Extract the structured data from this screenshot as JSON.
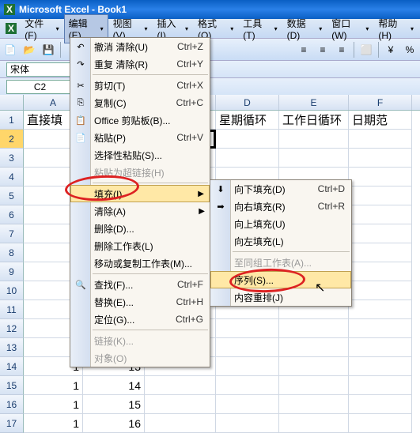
{
  "title": "Microsoft Excel - Book1",
  "menus": {
    "file": "文件(F)",
    "edit": "编辑(E)",
    "view": "视图(V)",
    "insert": "插入(I)",
    "format": "格式(O)",
    "tools": "工具(T)",
    "data": "数据(D)",
    "window": "窗口(W)",
    "help": "帮助(H)"
  },
  "font_name": "宋体",
  "name_box": "C2",
  "columns": [
    "A",
    "B",
    "C",
    "D",
    "E",
    "F"
  ],
  "header_row": {
    "A": "直接填",
    "D": "星期循环",
    "E": "工作日循环",
    "F": "日期范"
  },
  "data_rows": [
    {
      "n": 14,
      "A": "1",
      "B": "13"
    },
    {
      "n": 15,
      "A": "1",
      "B": "14"
    },
    {
      "n": 16,
      "A": "1",
      "B": "15"
    },
    {
      "n": 17,
      "A": "1",
      "B": "16"
    }
  ],
  "edit_menu": [
    {
      "icon": "↶",
      "label": "撤消 清除(U)",
      "shortcut": "Ctrl+Z"
    },
    {
      "icon": "↷",
      "label": "重复 清除(R)",
      "shortcut": "Ctrl+Y"
    },
    {
      "sep": true
    },
    {
      "icon": "✂",
      "label": "剪切(T)",
      "shortcut": "Ctrl+X"
    },
    {
      "icon": "⎘",
      "label": "复制(C)",
      "shortcut": "Ctrl+C"
    },
    {
      "icon": "📋",
      "label": "Office 剪贴板(B)..."
    },
    {
      "icon": "📄",
      "label": "粘贴(P)",
      "shortcut": "Ctrl+V"
    },
    {
      "label": "选择性粘贴(S)..."
    },
    {
      "label": "粘贴为超链接(H)",
      "disabled": true
    },
    {
      "sep": true
    },
    {
      "label": "填充(I)",
      "arrow": true,
      "hover": true
    },
    {
      "label": "清除(A)",
      "arrow": true
    },
    {
      "label": "删除(D)..."
    },
    {
      "label": "删除工作表(L)"
    },
    {
      "label": "移动或复制工作表(M)..."
    },
    {
      "sep": true
    },
    {
      "icon": "🔍",
      "label": "查找(F)...",
      "shortcut": "Ctrl+F"
    },
    {
      "label": "替换(E)...",
      "shortcut": "Ctrl+H"
    },
    {
      "label": "定位(G)...",
      "shortcut": "Ctrl+G"
    },
    {
      "sep": true
    },
    {
      "label": "链接(K)...",
      "disabled": true
    },
    {
      "label": "对象(O)",
      "disabled": true
    }
  ],
  "fill_submenu": [
    {
      "icon": "⬇",
      "label": "向下填充(D)",
      "shortcut": "Ctrl+D"
    },
    {
      "icon": "➡",
      "label": "向右填充(R)",
      "shortcut": "Ctrl+R"
    },
    {
      "label": "向上填充(U)"
    },
    {
      "label": "向左填充(L)"
    },
    {
      "sep": true
    },
    {
      "label": "至同组工作表(A)...",
      "disabled": true
    },
    {
      "label": "序列(S)...",
      "hover": true
    },
    {
      "label": "内容重排(J)"
    }
  ]
}
